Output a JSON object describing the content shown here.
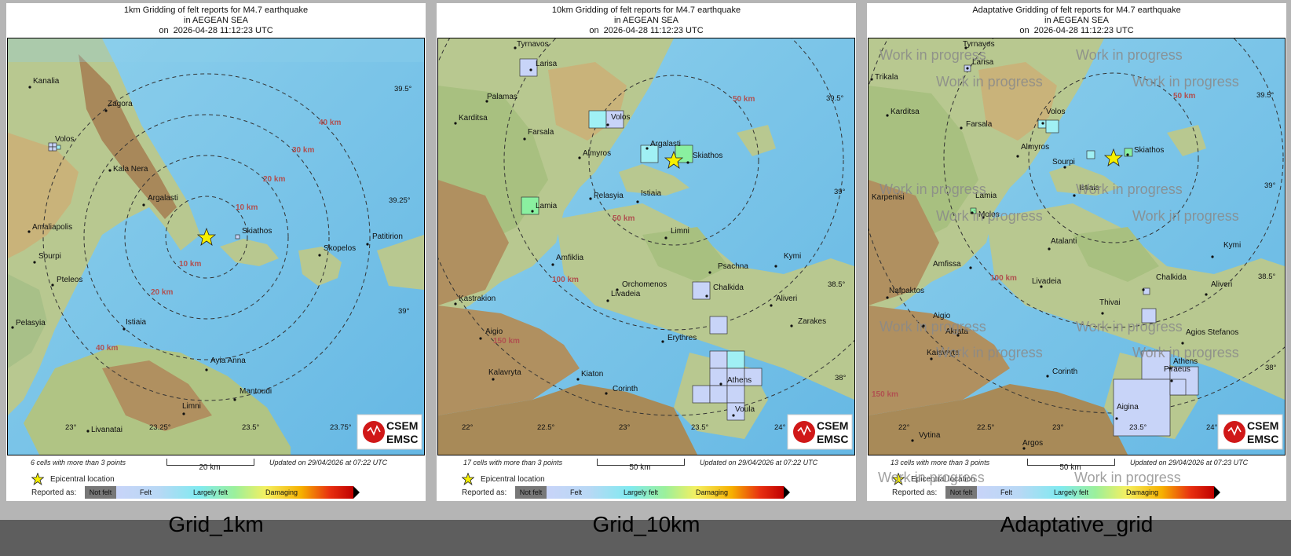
{
  "panels": [
    {
      "title_lines": [
        "1km Gridding of felt reports for M4.7 earthquake",
        "in AEGEAN SEA",
        "on  2026-04-28 11:12:23 UTC"
      ],
      "cells_note": "6 cells with more than 3 points",
      "scale_label": "20 km",
      "updated": "Updated on 29/04/2026 at 07:22 UTC",
      "caption": "Grid_1km",
      "places": [
        "Kanalia",
        "Zagora",
        "Volos",
        "Kala Nera",
        "Argalasti",
        "Amaliapolis",
        "Sourpi",
        "Pteleos",
        "Pelasyia",
        "Istiaia",
        "Skiathos",
        "Skopelos",
        "Patitirion",
        "Ayia Anna",
        "Mantoudi",
        "Limni",
        "Livanatai"
      ],
      "distances": [
        "40 km",
        "30 km",
        "20 km",
        "10 km",
        "10 km",
        "20 km",
        "40 km"
      ],
      "coords": [
        "39.5°",
        "39.25°",
        "39°",
        "23°",
        "23.25°",
        "23.5°",
        "23.75°"
      ]
    },
    {
      "title_lines": [
        "10km Gridding of felt reports for M4.7 earthquake",
        "in AEGEAN SEA",
        "on  2026-04-28 11:12:23 UTC"
      ],
      "cells_note": "17 cells with more than 3 points",
      "scale_label": "50 km",
      "updated": "Updated on 29/04/2026 at 07:22 UTC",
      "caption": "Grid_10km",
      "places": [
        "Tyrnavos",
        "Larisa",
        "Palamas",
        "Karditsa",
        "Farsala",
        "Volos",
        "Almyros",
        "Argalasti",
        "Skiathos",
        "Lamia",
        "Pelasyia",
        "Istiaia",
        "Limni",
        "Amfiklia",
        "Orchomenos",
        "Livadeia",
        "Psachna",
        "Kymi",
        "Chalkida",
        "Aliveri",
        "Kastrakion",
        "Aigio",
        "Erythres",
        "Zarakes",
        "Kiaton",
        "Corinth",
        "Athens",
        "Kalavryta",
        "Voula"
      ],
      "distances": [
        "50 km",
        "50 km",
        "100 km",
        "150 km"
      ],
      "coords": [
        "39.5°",
        "39°",
        "38.5°",
        "38°",
        "22°",
        "22.5°",
        "23°",
        "23.5°",
        "24°"
      ]
    },
    {
      "title_lines": [
        "Adaptative Gridding of felt reports for M4.7 earthquake",
        "in AEGEAN SEA",
        "on  2026-04-28 11:12:23 UTC"
      ],
      "cells_note": "13 cells with more than 3 points",
      "scale_label": "50 km",
      "updated": "Updated on 29/04/2026 at 07:23 UTC",
      "caption": "Adaptative_grid",
      "places": [
        "Tyrnavos",
        "Larisa",
        "Trikala",
        "Karditsa",
        "Farsala",
        "Volos",
        "Almyros",
        "Sourpi",
        "Skiathos",
        "Karpenisi",
        "Lamia",
        "Molos",
        "Istiaia",
        "Atalanti",
        "Kymi",
        "Amfissa",
        "Chalkida",
        "Nafpaktos",
        "Livadeia",
        "Aliveri",
        "Thivai",
        "Aigio",
        "Akrata",
        "Agios Stefanos",
        "Kalavryta",
        "Athens",
        "Corinth",
        "Piraeus",
        "Aigina",
        "Vytina",
        "Argos"
      ],
      "distances": [
        "50 km",
        "100 km",
        "150 km"
      ],
      "coords": [
        "39.5°",
        "39°",
        "38.5°",
        "38°",
        "22°",
        "22.5°",
        "23°",
        "23.5°",
        "24°"
      ],
      "watermark": "Work in progress"
    }
  ],
  "legend": {
    "epicentral": "Epicentral location",
    "reported_as": "Reported as:",
    "not_felt": "Not felt",
    "felt": "Felt",
    "largely_felt": "Largely felt",
    "damaging": "Damaging"
  },
  "logo": {
    "top": "CSEM",
    "bottom": "EMSC"
  }
}
